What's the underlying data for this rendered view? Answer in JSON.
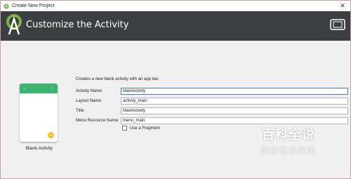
{
  "window": {
    "title": "Create New Project"
  },
  "header": {
    "title": "Customize the Activity"
  },
  "template": {
    "name": "Blank Activity"
  },
  "form": {
    "description": "Creates a new blank activity with an app bar.",
    "fields": [
      {
        "label": "Activity Name:",
        "value": "MainActivity"
      },
      {
        "label": "Layout Name:",
        "value": "activity_main"
      },
      {
        "label": "Title:",
        "value": "MainActivity"
      },
      {
        "label": "Menu Resource Name:",
        "value": "menu_main"
      }
    ],
    "fragment_checkbox": {
      "label": "Use a Fragment",
      "checked": false
    }
  },
  "watermark": {
    "main": "百科全说",
    "sub": "助你轻松解决"
  },
  "colors": {
    "header_bg": "#3c3f41",
    "appbar": "#39b56f",
    "fab": "#f2c010",
    "focus": "#3d7cc9"
  },
  "icons": {
    "app": "android-studio-icon",
    "logo": "android-studio-logo-icon",
    "device": "device-frame-icon",
    "fab": "fab-icon"
  }
}
